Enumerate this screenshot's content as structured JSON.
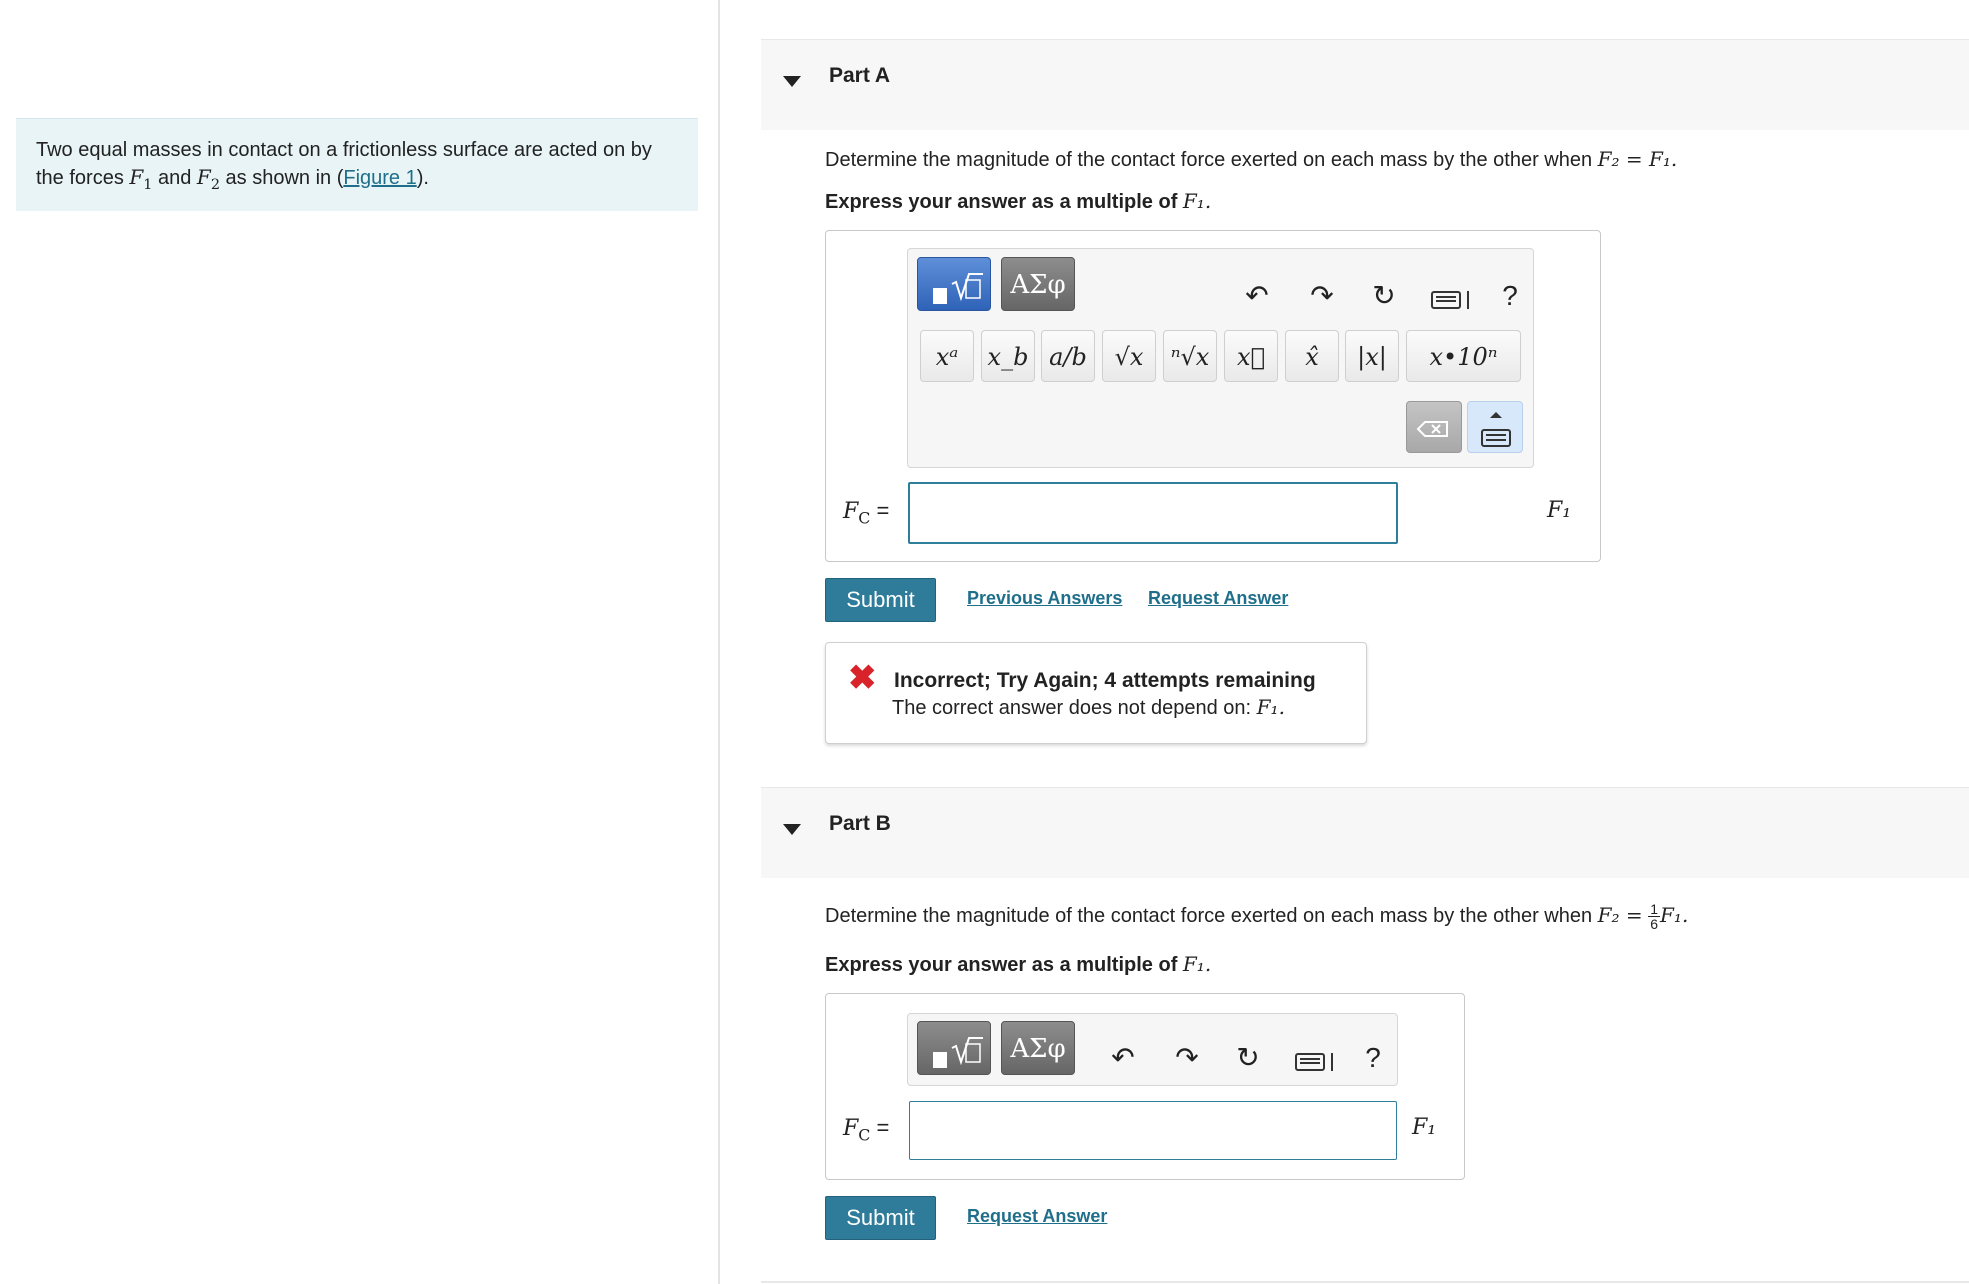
{
  "intro": {
    "text_1": "Two equal masses in contact on a frictionless surface are acted on by the forces ",
    "f1": "F",
    "and": " and ",
    "f2": "F",
    "text_2": " as shown in (",
    "figure_link": "Figure 1",
    "text_3": ")."
  },
  "partA": {
    "title": "Part A",
    "question_prefix": "Determine the magnitude of the contact force exerted on each mass by the other when ",
    "question_math": "F₂ = F₁.",
    "instruction_prefix": "Express your answer as a multiple of ",
    "instruction_math": "F₁.",
    "toolbar": {
      "greek_label": "ΑΣφ",
      "undo": "↶",
      "redo": "↷",
      "reset": "↻",
      "help": "?"
    },
    "keys": [
      "xᵃ",
      "x_b",
      "a/b",
      "√x",
      "ⁿ√x",
      "x⃗",
      "x̂",
      "|x|",
      "x•10ⁿ"
    ],
    "fc_label": "F",
    "fc_sub": "C",
    "equals": "=",
    "input_value": "",
    "unit": "F₁",
    "submit": "Submit",
    "previous_answers": "Previous Answers",
    "request_answer": "Request Answer",
    "feedback": {
      "icon": "✖",
      "heading": "Incorrect; Try Again; 4 attempts remaining",
      "body_prefix": "The correct answer does not depend on: ",
      "body_math": "F₁."
    }
  },
  "partB": {
    "title": "Part B",
    "question_prefix": "Determine the magnitude of the contact force exerted on each mass by the other when ",
    "question_math_lhs": "F₂ =",
    "frac_num": "1",
    "frac_den": "6",
    "question_math_rhs": "F₁.",
    "instruction_prefix": "Express your answer as a multiple of ",
    "instruction_math": "F₁.",
    "toolbar": {
      "greek_label": "ΑΣφ",
      "undo": "↶",
      "redo": "↷",
      "reset": "↻",
      "help": "?"
    },
    "fc_label": "F",
    "fc_sub": "C",
    "equals": "=",
    "input_value": "",
    "unit": "F₁",
    "submit": "Submit",
    "request_answer": "Request Answer"
  }
}
